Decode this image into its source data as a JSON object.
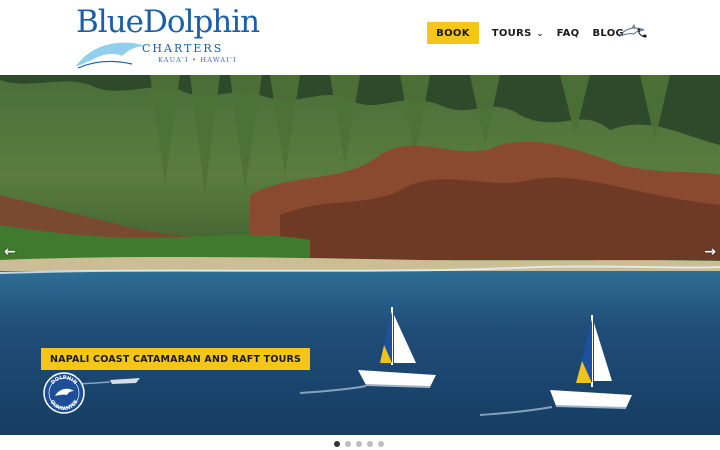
{
  "brand": {
    "name": "BlueDolphin",
    "subtitle": "CHARTERS",
    "location": "KAUA'I • HAWAI'I"
  },
  "nav": {
    "book_label": "BOOK",
    "tours_label": "TOURS",
    "faq_label": "FAQ",
    "blog_label": "BLOG",
    "icons": [
      "phone-icon",
      "dolphin-icon",
      "chevron-down-icon"
    ]
  },
  "hero": {
    "caption": "NAPALI COAST CATAMARAN AND RAFT TOURS",
    "badge_text": "DOLPHIN GUARANTEE",
    "slide_count": 5,
    "active_slide": 1
  },
  "colors": {
    "accent": "#f5c518",
    "brand_blue": "#1b5fa8",
    "ocean": "#1f4d78",
    "cliffs": "#8a4a2f",
    "vegetation": "#3d7a32"
  }
}
